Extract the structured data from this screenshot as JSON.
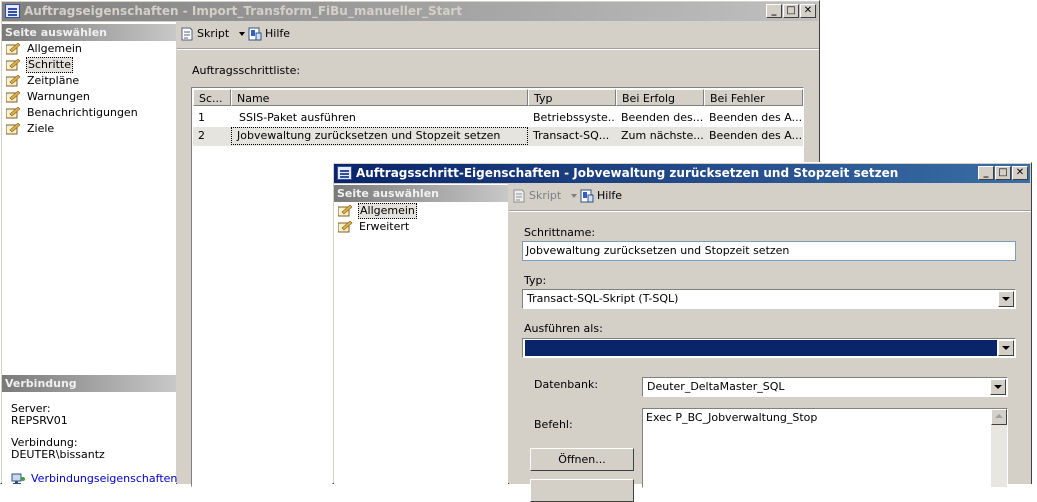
{
  "main_window": {
    "title": "Auftragseigenschaften - Import_Transform_FiBu_manueller_Start",
    "select_page_header": "Seite auswählen",
    "pages": [
      "Allgemein",
      "Schritte",
      "Zeitpläne",
      "Warnungen",
      "Benachrichtigungen",
      "Ziele"
    ],
    "selected_page": "Schritte",
    "toolbar": {
      "script_label": "Skript",
      "help_label": "Hilfe"
    },
    "step_list_label": "Auftragsschrittliste:",
    "steps_table": {
      "columns": [
        "Sc...",
        "Name",
        "Typ",
        "Bei Erfolg",
        "Bei Fehler"
      ],
      "rows": [
        [
          "1",
          "SSIS-Paket ausführen",
          "Betriebssyste...",
          "Beenden des...",
          "Beenden des A..."
        ],
        [
          "2",
          "Jobvewaltung zurücksetzen und Stopzeit setzen",
          "Transact-SQ...",
          "Zum nächste...",
          "Beenden des A..."
        ]
      ],
      "selected_row": 2
    },
    "connection": {
      "header": "Verbindung",
      "server_label": "Server:",
      "server_value": "REPSRV01",
      "connection_label": "Verbindung:",
      "connection_value": "DEUTER\\bissantz",
      "properties_link": "Verbindungseigenschaften"
    }
  },
  "step_window": {
    "title": "Auftragsschritt-Eigenschaften - Jobvewaltung zurücksetzen und Stopzeit setzen",
    "select_page_header": "Seite auswählen",
    "pages": [
      "Allgemein",
      "Erweitert"
    ],
    "selected_page": "Allgemein",
    "toolbar": {
      "script_label": "Skript",
      "help_label": "Hilfe"
    },
    "step_name_label": "Schrittname:",
    "step_name_value": "Jobvewaltung zurücksetzen und Stopzeit setzen",
    "type_label": "Typ:",
    "type_value": "Transact-SQL-Skript (T-SQL)",
    "run_as_label": "Ausführen als:",
    "run_as_value": "",
    "database_label": "Datenbank:",
    "database_value": "Deuter_DeltaMaster_SQL",
    "command_label": "Befehl:",
    "command_value": "Exec P_BC_Jobverwaltung_Stop",
    "open_button": "Öffnen..."
  },
  "caption_buttons": {
    "minimize": "_",
    "maximize": "□",
    "close": "✕"
  }
}
